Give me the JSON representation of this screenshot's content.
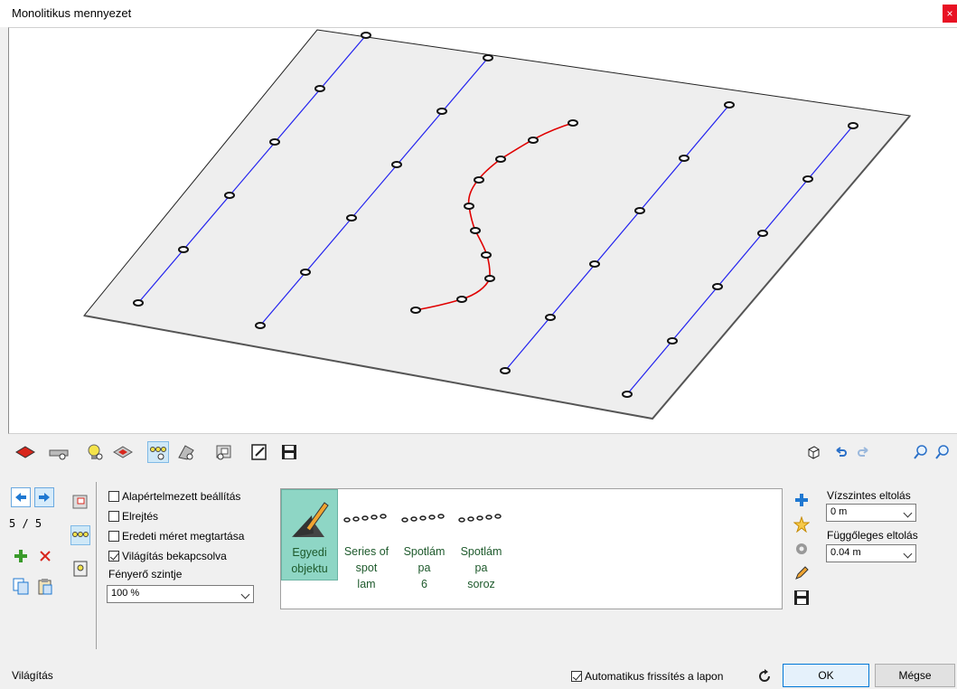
{
  "window": {
    "title": "Monolitikus mennyezet",
    "close_symbol": "×"
  },
  "navigator": {
    "counter": "5 / 5"
  },
  "options": {
    "default_settings": {
      "label": "Alapértelmezett beállítás",
      "checked": false
    },
    "hide": {
      "label": "Elrejtés",
      "checked": false
    },
    "keep_original_size": {
      "label": "Eredeti méret megtartása",
      "checked": false
    },
    "lighting_on": {
      "label": "Világítás bekapcsolva",
      "checked": true
    },
    "brightness_label": "Fényerő szintje",
    "brightness_value": "100 %"
  },
  "library": {
    "items": [
      {
        "name": "Egyedi objektu",
        "icon": "custom-object-icon"
      },
      {
        "name": "Series of spot lam",
        "icon": "spotlight-series-icon"
      },
      {
        "name": "Spotlám pa 6",
        "icon": "spotlight-series-icon"
      },
      {
        "name": "Spotlám pa soroz",
        "icon": "spotlight-series-icon"
      }
    ]
  },
  "offsets": {
    "horizontal_label": "Vízszintes eltolás",
    "horizontal_value": "0 m",
    "vertical_label": "Függőleges eltolás",
    "vertical_value": "0.04 m"
  },
  "footer": {
    "section_label": "Világítás",
    "auto_refresh_label": "Automatikus frissítés a lapon",
    "auto_refresh_checked": true,
    "ok_label": "OK",
    "cancel_label": "Mégse"
  },
  "colors": {
    "accent": "#0078d7",
    "selected_item": "#8ed6c5",
    "spline": "#e00000",
    "line": "#1a1aff"
  }
}
